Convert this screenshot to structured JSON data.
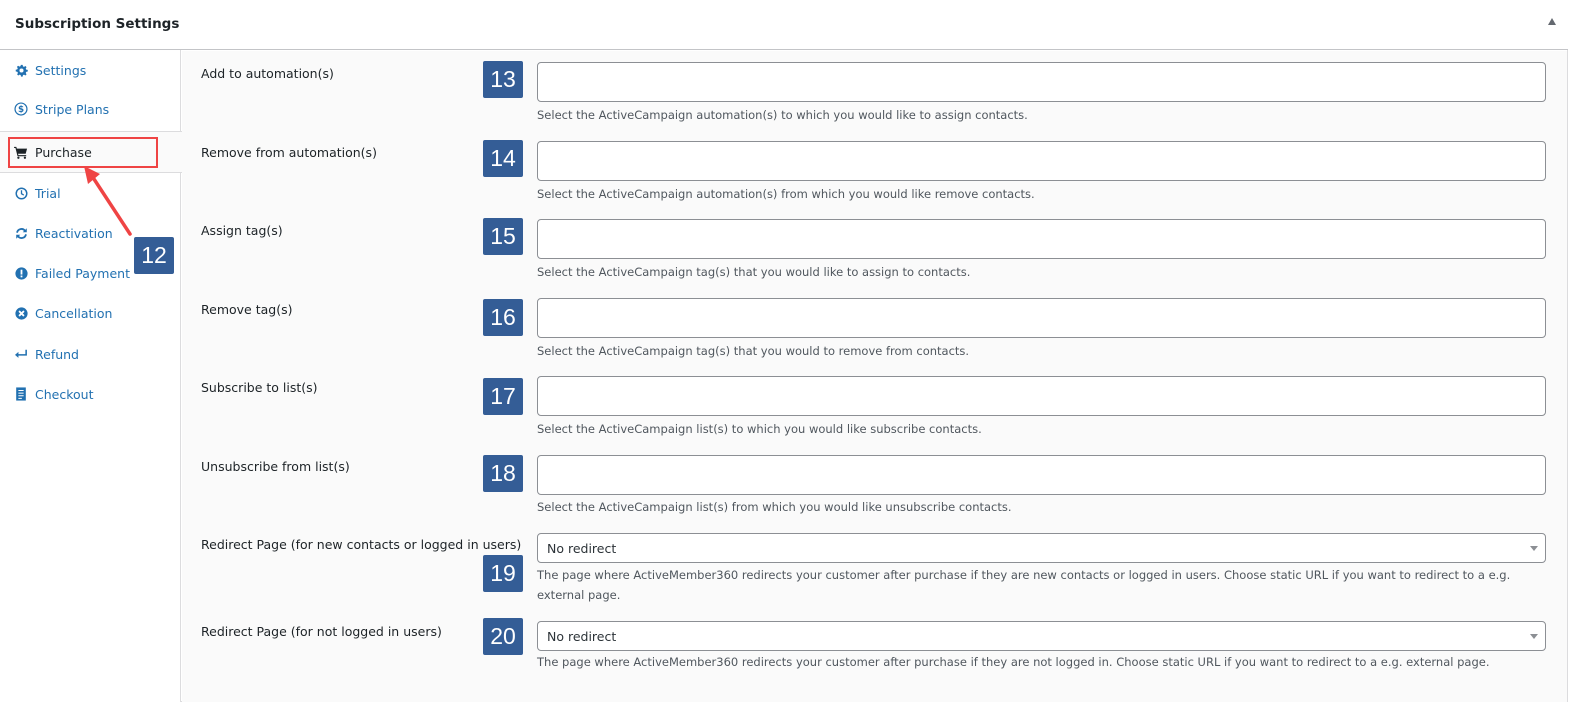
{
  "panel": {
    "title": "Subscription Settings"
  },
  "sidebar": {
    "items": [
      {
        "label": "Settings",
        "icon": "gear-icon"
      },
      {
        "label": "Stripe Plans",
        "icon": "dollar-circle-icon"
      },
      {
        "label": "Purchase",
        "icon": "cart-icon",
        "active": true
      },
      {
        "label": "Trial",
        "icon": "clock-icon"
      },
      {
        "label": "Reactivation",
        "icon": "refresh-icon"
      },
      {
        "label": "Failed Payment",
        "icon": "exclamation-circle-icon"
      },
      {
        "label": "Cancellation",
        "icon": "x-circle-icon"
      },
      {
        "label": "Refund",
        "icon": "return-arrow-icon"
      },
      {
        "label": "Checkout",
        "icon": "document-icon"
      }
    ]
  },
  "annotations": {
    "sidebar_badge": "12",
    "highlight_color": "#ef4444",
    "badge_color": "#345d96"
  },
  "fields": [
    {
      "label": "Add to automation(s)",
      "value": "",
      "help": "Select the ActiveCampaign automation(s) to which you would like to assign contacts.",
      "badge": "13"
    },
    {
      "label": "Remove from automation(s)",
      "value": "",
      "help": "Select the ActiveCampaign automation(s) from which you would like remove contacts.",
      "badge": "14"
    },
    {
      "label": "Assign tag(s)",
      "value": "",
      "help": "Select the ActiveCampaign tag(s) that you would like to assign to contacts.",
      "badge": "15"
    },
    {
      "label": "Remove tag(s)",
      "value": "",
      "help": "Select the ActiveCampaign tag(s) that you would to remove from contacts.",
      "badge": "16"
    },
    {
      "label": "Subscribe to list(s)",
      "value": "",
      "help": "Select the ActiveCampaign list(s) to which you would like subscribe contacts.",
      "badge": "17"
    },
    {
      "label": "Unsubscribe from list(s)",
      "value": "",
      "help": "Select the ActiveCampaign list(s) from which you would like unsubscribe contacts.",
      "badge": "18"
    }
  ],
  "selects": [
    {
      "label": "Redirect Page (for new contacts or logged in users)",
      "value": "No redirect",
      "help_line1": "The page where ActiveMember360 redirects your customer after purchase if they are new contacts or logged in users. Choose static URL if you want to redirect to a e.g.",
      "help_line2": "external page.",
      "badge": "19"
    },
    {
      "label": "Redirect Page (for not logged in users)",
      "value": "No redirect",
      "help_line1": "The page where ActiveMember360 redirects your customer after purchase if they are not logged in. Choose static URL if you want to redirect to a e.g. external page.",
      "badge": "20"
    }
  ]
}
